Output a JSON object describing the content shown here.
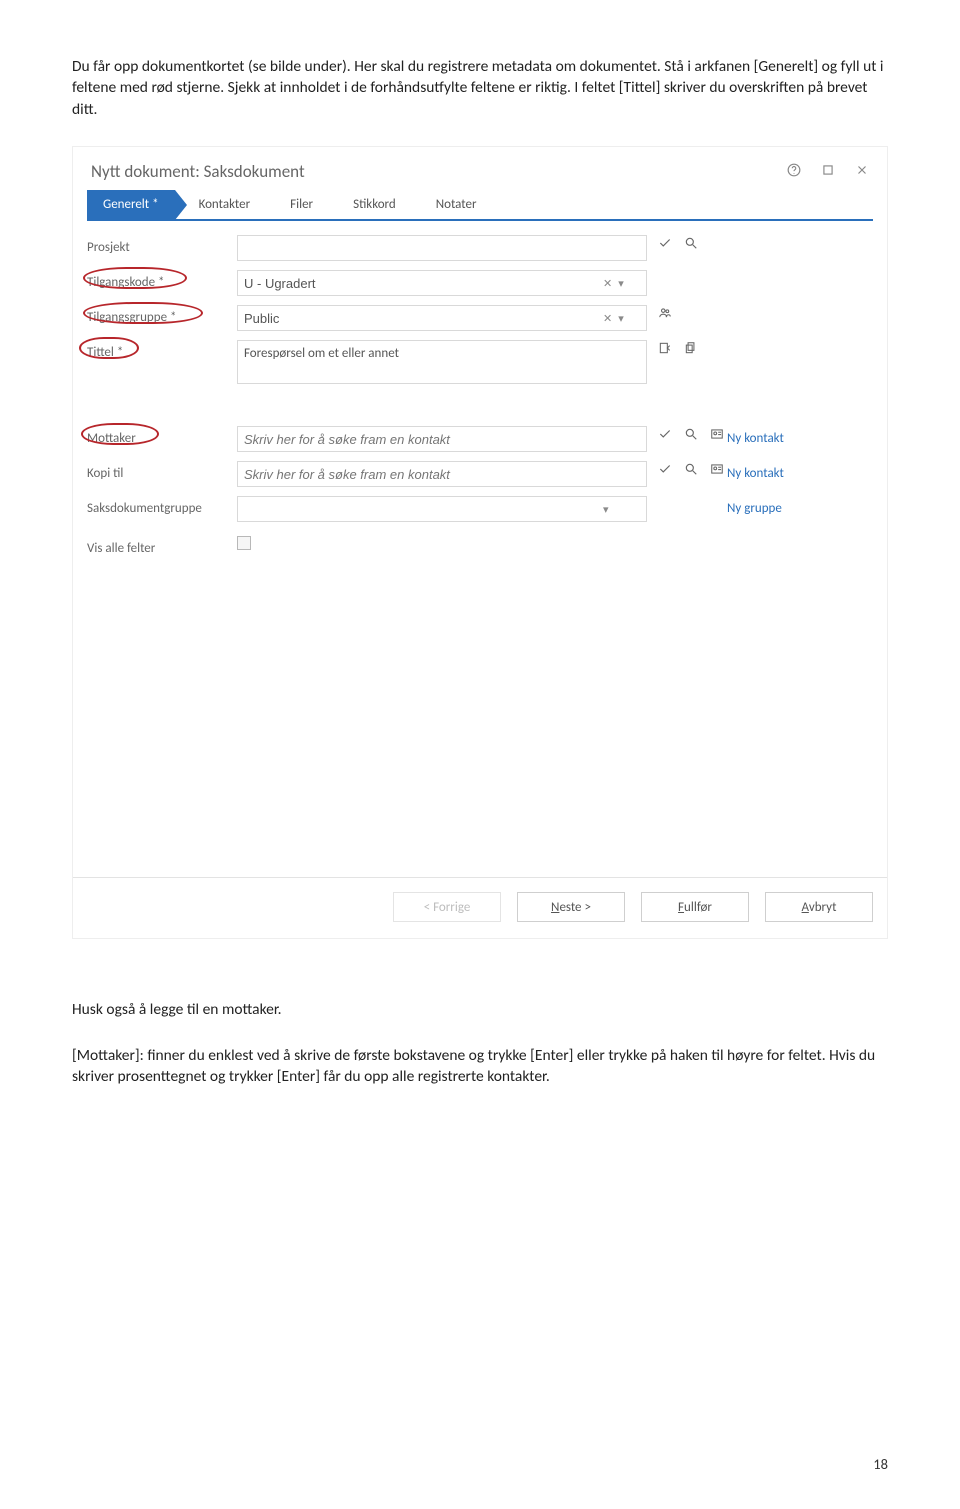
{
  "intro_text": "Du får opp dokumentkortet (se bilde under). Her skal du registrere metadata om dokumentet. Stå i arkfanen [Generelt] og fyll ut i feltene med rød stjerne. Sjekk at innholdet i de forhåndsutfylte feltene er riktig. I feltet [Tittel] skriver du overskriften på brevet ditt.",
  "dialog": {
    "title": "Nytt dokument: Saksdokument",
    "tabs": {
      "active": "Generelt *",
      "others": [
        "Kontakter",
        "Filer",
        "Stikkord",
        "Notater"
      ]
    },
    "fields": {
      "prosjekt": {
        "label": "Prosjekt",
        "value": ""
      },
      "tilgangskode": {
        "label": "Tilgangskode *",
        "value": "U - Ugradert"
      },
      "tilgangsgruppe": {
        "label": "Tilgangsgruppe *",
        "value": "Public"
      },
      "tittel": {
        "label": "Tittel *",
        "value": "Forespørsel om et eller annet"
      },
      "mottaker": {
        "label": "Mottaker",
        "placeholder": "Skriv her for å søke fram en kontakt",
        "link": "Ny kontakt"
      },
      "kopi": {
        "label": "Kopi til",
        "placeholder": "Skriv her for å søke fram en kontakt",
        "link": "Ny kontakt"
      },
      "gruppe": {
        "label": "Saksdokumentgruppe",
        "value": "",
        "link": "Ny gruppe"
      },
      "visalle": {
        "label": "Vis alle felter"
      }
    },
    "buttons": {
      "prev": "< Forrige",
      "next": "Neste >",
      "finish": "Fullfør",
      "cancel": "Avbryt"
    }
  },
  "outro1": "Husk også å legge til en mottaker.",
  "outro2": "[Mottaker]: finner du enklest ved å skrive de første bokstavene og trykke [Enter] eller trykke på haken til høyre for feltet. Hvis du skriver prosenttegnet og trykker [Enter] får du opp alle registrerte kontakter.",
  "page_number": "18"
}
